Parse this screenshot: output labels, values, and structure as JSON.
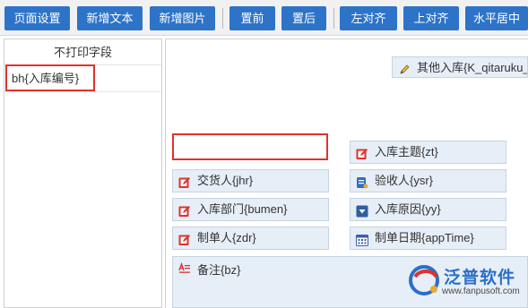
{
  "toolbar": {
    "buttons": [
      {
        "label": "页面设置"
      },
      {
        "label": "新增文本"
      },
      {
        "label": "新增图片"
      },
      {
        "label": "置前"
      },
      {
        "label": "置后"
      },
      {
        "label": "左对齐"
      },
      {
        "label": "上对齐"
      },
      {
        "label": "水平居中"
      }
    ]
  },
  "left_panel": {
    "header": "不打印字段",
    "items": [
      {
        "label": "bh{入库编号}"
      }
    ]
  },
  "canvas": {
    "title_field": "其他入库{K_qitaruku_",
    "fields": {
      "subject": "入库主题{zt}",
      "deliverer": "交货人{jhr}",
      "inspector": "验收人{ysr}",
      "department": "入库部门{bumen}",
      "reason": "入库原因{yy}",
      "creator": "制单人{zdr}",
      "create_date": "制单日期{appTime}",
      "remark": "备注{bz}"
    }
  },
  "watermark": {
    "brand": "泛普软件",
    "url": "www.fanpusoft.com"
  },
  "colors": {
    "toolbar_button": "#2d74c9",
    "field_bg": "#e6eef7",
    "highlight_red": "#e0322e",
    "icon_red": "#d9332e",
    "icon_blue": "#2f5f9e"
  }
}
